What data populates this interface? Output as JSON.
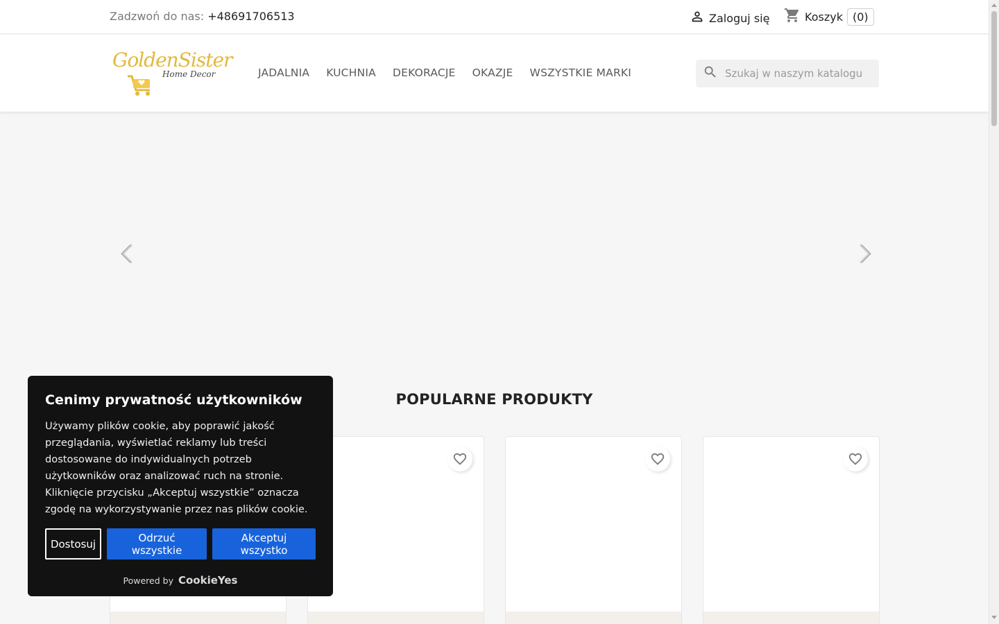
{
  "topbar": {
    "call_label": "Zadzwoń do nas:",
    "phone": "+48691706513",
    "login_label": "Zaloguj się",
    "cart_label": "Koszyk",
    "cart_count": "(0)"
  },
  "header": {
    "logo_text": "GoldenSister",
    "logo_sub": "Home Decor",
    "nav": [
      "JADALNIA",
      "KUCHNIA",
      "DEKORACJE",
      "OKAZJE",
      "WSZYSTKIE MARKI"
    ],
    "search_placeholder": "Szukaj w naszym katalogu"
  },
  "popular": {
    "title": "POPULARNE PRODUKTY"
  },
  "cookie": {
    "title": "Cenimy prywatność użytkowników",
    "text": "Używamy plików cookie, aby poprawić jakość przeglądania, wyświetlać reklamy lub treści dostosowane do indywidualnych potrzeb użytkowników oraz analizować ruch na stronie. Kliknięcie przycisku „Akceptuj wszystkie” oznacza zgodę na wykorzystywanie przez nas plików cookie.",
    "customize_label": "Dostosuj",
    "reject_label": "Odrzuć wszystkie",
    "accept_label": "Akceptuj wszystko",
    "powered_label": "Powered by",
    "powered_brand": "CookieYes"
  },
  "colors": {
    "accent_blue": "#1863dc",
    "banner_bg": "#121212",
    "logo_gold": "#e2b93b"
  }
}
